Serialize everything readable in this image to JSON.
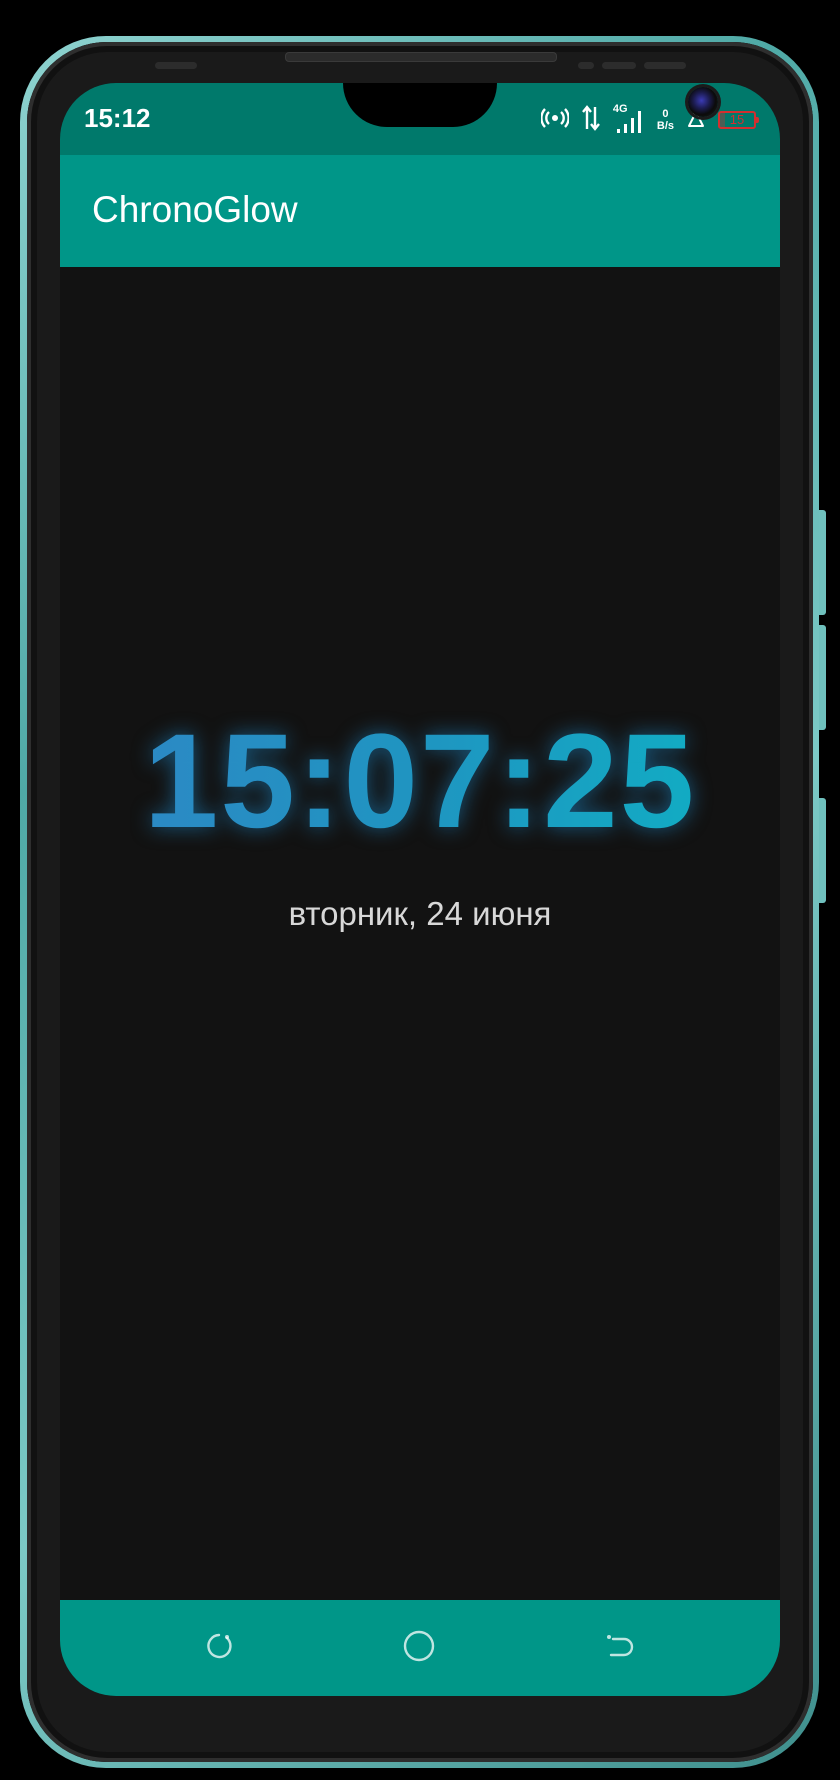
{
  "status_bar": {
    "time": "15:12",
    "network_type": "4G",
    "net_speed_value": "0",
    "net_speed_unit": "B/s",
    "battery_level": "15",
    "battery_fraction": 0.15,
    "icons": [
      "hotspot-icon",
      "data-transfer-icon",
      "signal-icon",
      "lab-flask-icon",
      "battery-icon"
    ]
  },
  "app_bar": {
    "title": "ChronoGlow"
  },
  "clock": {
    "time": "15:07:25",
    "date": "вторник, 24 июня",
    "gradient_start": "#2f86c5",
    "gradient_end": "#0eb2c4"
  },
  "nav_bar": {
    "buttons": [
      "recents-icon",
      "home-icon",
      "back-icon"
    ]
  },
  "colors": {
    "accent": "#009688",
    "status_bar": "#00796b",
    "background": "#121212",
    "frame": "#7cc9c6",
    "battery_low": "#d32f2f"
  }
}
